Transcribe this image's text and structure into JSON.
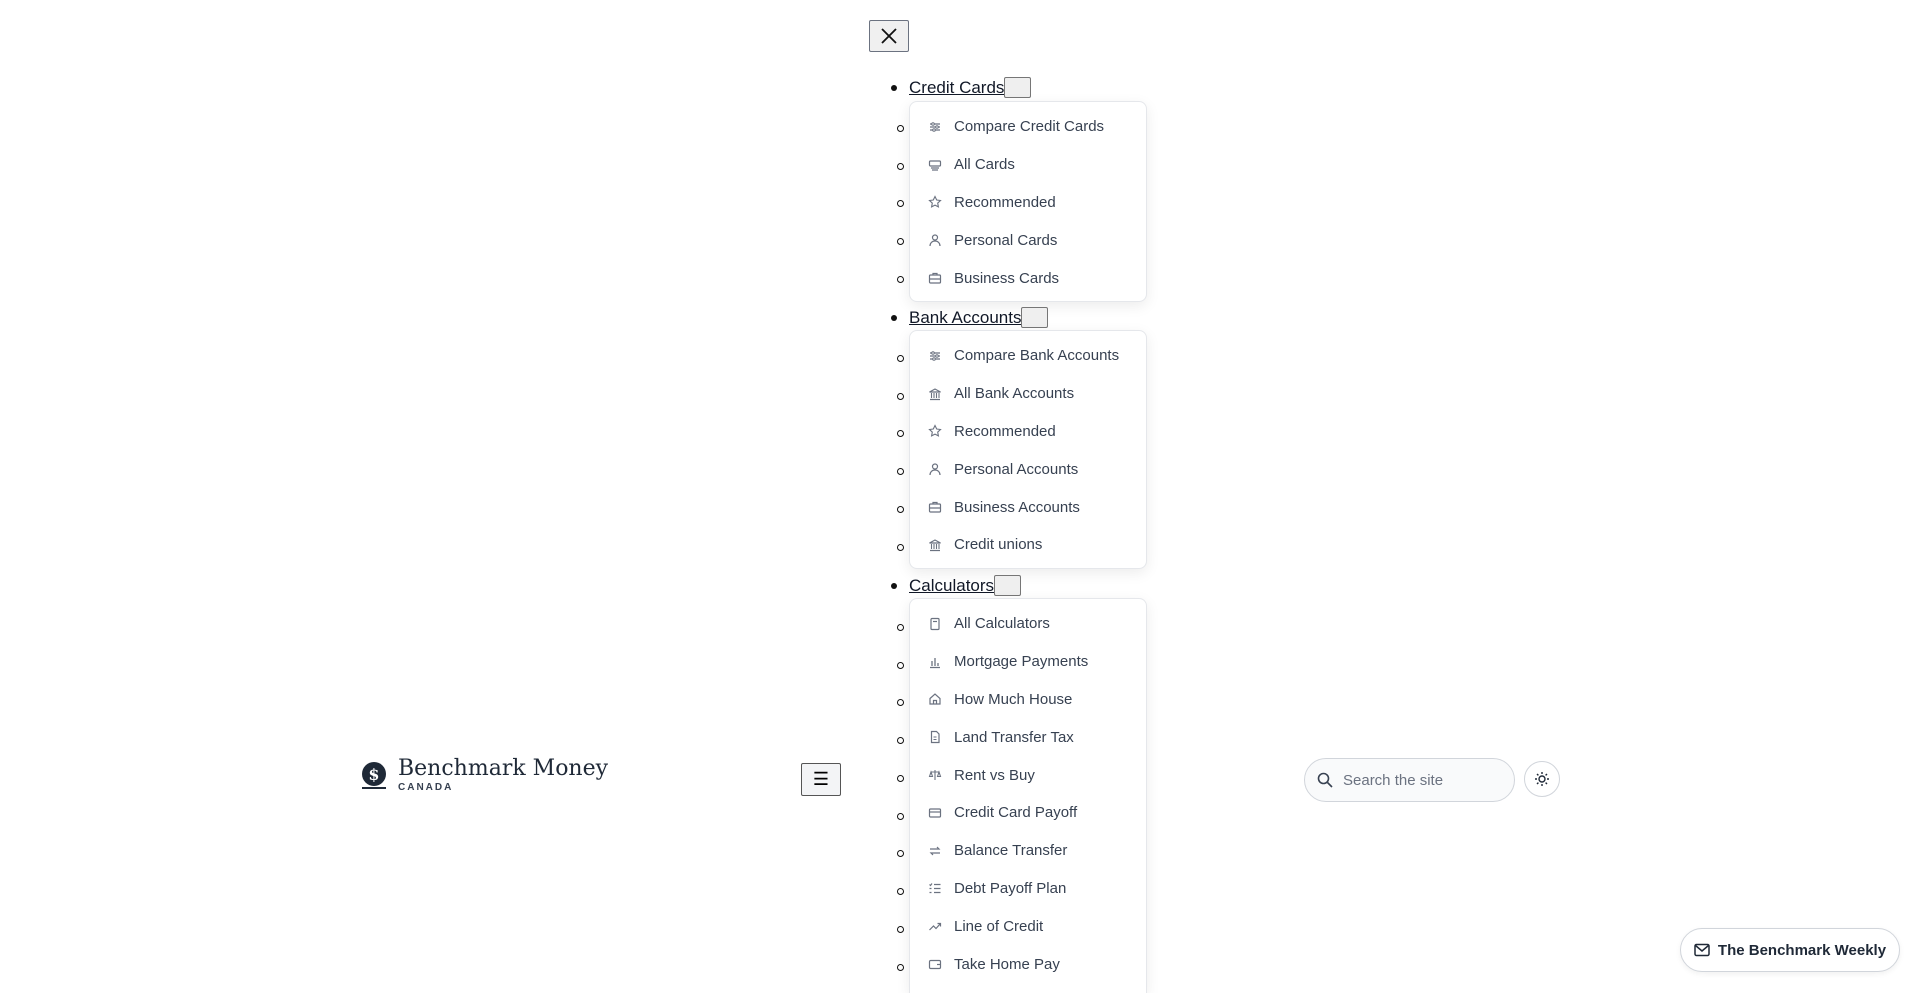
{
  "nav": {
    "close_label": "✕",
    "sections": [
      {
        "label": "Credit Cards",
        "items": [
          {
            "label": "Compare Credit Cards",
            "icon": "sliders-icon"
          },
          {
            "label": "All Cards",
            "icon": "card-stack-icon"
          },
          {
            "label": "Recommended",
            "icon": "star-icon"
          },
          {
            "label": "Personal Cards",
            "icon": "person-icon"
          },
          {
            "label": "Business Cards",
            "icon": "briefcase-icon"
          }
        ]
      },
      {
        "label": "Bank Accounts",
        "items": [
          {
            "label": "Compare Bank Accounts",
            "icon": "sliders-icon"
          },
          {
            "label": "All Bank Accounts",
            "icon": "bank-icon"
          },
          {
            "label": "Recommended",
            "icon": "star-icon"
          },
          {
            "label": "Personal Accounts",
            "icon": "person-icon"
          },
          {
            "label": "Business Accounts",
            "icon": "briefcase-icon"
          },
          {
            "label": "Credit unions",
            "icon": "bank-icon"
          }
        ]
      },
      {
        "label": "Calculators",
        "items": [
          {
            "label": "All Calculators",
            "icon": "calculator-icon"
          },
          {
            "label": "Mortgage Payments",
            "icon": "bar-chart-icon"
          },
          {
            "label": "How Much House",
            "icon": "house-icon"
          },
          {
            "label": "Land Transfer Tax",
            "icon": "document-icon"
          },
          {
            "label": "Rent vs Buy",
            "icon": "scale-icon"
          },
          {
            "label": "Credit Card Payoff",
            "icon": "credit-card-icon"
          },
          {
            "label": "Balance Transfer",
            "icon": "arrows-swap-icon"
          },
          {
            "label": "Debt Payoff Plan",
            "icon": "checklist-icon"
          },
          {
            "label": "Line of Credit",
            "icon": "trend-up-icon"
          },
          {
            "label": "Take Home Pay",
            "icon": "wallet-icon"
          }
        ]
      }
    ]
  },
  "header": {
    "brand_name": "Benchmark Money",
    "brand_sub": "CANADA",
    "menu_label": "☰",
    "search_placeholder": "Search the site"
  },
  "newsletter": {
    "label": "The Benchmark Weekly"
  },
  "colors": {
    "text": "#1f2937",
    "border": "#e5e7eb",
    "muted": "#6b7280"
  }
}
